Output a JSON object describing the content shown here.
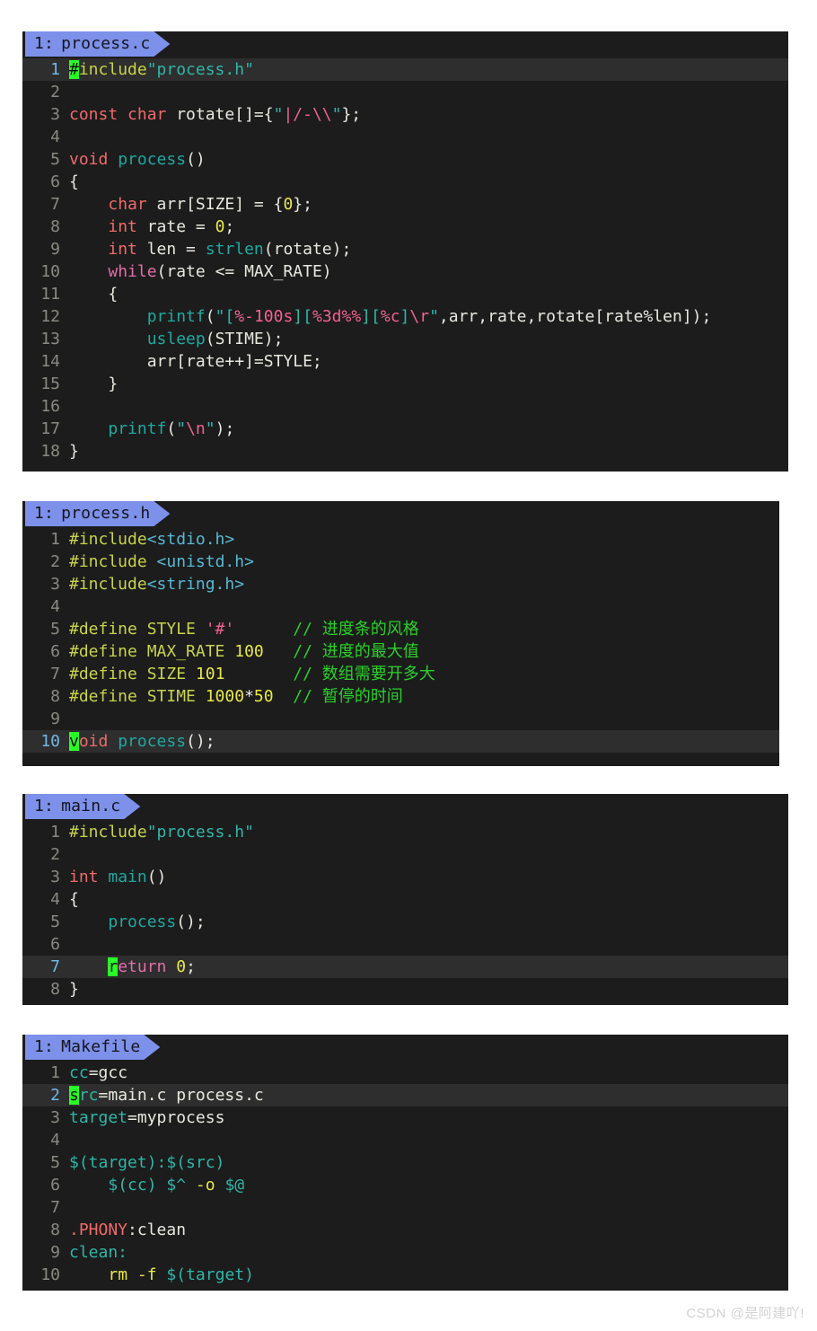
{
  "watermark": "CSDN @是阿建吖!",
  "colors": {
    "page_background": "#ffffff",
    "editor_background": "#1c1c1c",
    "tab_background": "#7d90ea",
    "highlight_line": "#2e2e2e",
    "cursor": "#27ff27",
    "line_number": "#8a8a82",
    "active_line_number": "#6fb8e8",
    "comment": "#2ad02a",
    "string": "#2fb6a8",
    "keyword": "#f06a6a",
    "control_keyword": "#e36ea8",
    "preprocessor": "#c8d44a",
    "number": "#e8e84a",
    "format_specifier": "#f06292"
  },
  "blocks": [
    {
      "tab_index": "1:",
      "filename": "process.c",
      "cursor_line": 1,
      "line_count": 18,
      "lines": [
        {
          "n": "1",
          "text": "#include\"process.h\""
        },
        {
          "n": "2",
          "text": ""
        },
        {
          "n": "3",
          "text": "const char rotate[]={\"|/-\\\\\"};"
        },
        {
          "n": "4",
          "text": ""
        },
        {
          "n": "5",
          "text": "void process()"
        },
        {
          "n": "6",
          "text": "{"
        },
        {
          "n": "7",
          "text": "    char arr[SIZE] = {0};"
        },
        {
          "n": "8",
          "text": "    int rate = 0;"
        },
        {
          "n": "9",
          "text": "    int len = strlen(rotate);"
        },
        {
          "n": "10",
          "text": "    while(rate <= MAX_RATE)"
        },
        {
          "n": "11",
          "text": "    {"
        },
        {
          "n": "12",
          "text": "        printf(\"[%-100s][%3d%%][%c]\\r\",arr,rate,rotate[rate%len]);"
        },
        {
          "n": "13",
          "text": "        usleep(STIME);"
        },
        {
          "n": "14",
          "text": "        arr[rate++]=STYLE;"
        },
        {
          "n": "15",
          "text": "    }"
        },
        {
          "n": "16",
          "text": ""
        },
        {
          "n": "17",
          "text": "    printf(\"\\n\");"
        },
        {
          "n": "18",
          "text": "}"
        }
      ]
    },
    {
      "tab_index": "1:",
      "filename": "process.h",
      "cursor_line": 10,
      "line_count": 10,
      "lines": [
        {
          "n": "1",
          "text": "#include<stdio.h>"
        },
        {
          "n": "2",
          "text": "#include <unistd.h>"
        },
        {
          "n": "3",
          "text": "#include<string.h>"
        },
        {
          "n": "4",
          "text": ""
        },
        {
          "n": "5",
          "text": "#define STYLE '#'        // 进度条的风格"
        },
        {
          "n": "6",
          "text": "#define MAX_RATE 100      // 进度的最大值"
        },
        {
          "n": "7",
          "text": "#define SIZE 101          // 数组需要开多大"
        },
        {
          "n": "8",
          "text": "#define STIME 1000*50     // 暂停的时间"
        },
        {
          "n": "9",
          "text": ""
        },
        {
          "n": "10",
          "text": "void process();"
        }
      ],
      "comments": [
        "// 进度条的风格",
        "// 进度的最大值",
        "// 数组需要开多大",
        "// 暂停的时间"
      ]
    },
    {
      "tab_index": "1:",
      "filename": "main.c",
      "cursor_line": 7,
      "line_count": 8,
      "lines": [
        {
          "n": "1",
          "text": "#include\"process.h\""
        },
        {
          "n": "2",
          "text": ""
        },
        {
          "n": "3",
          "text": "int main()"
        },
        {
          "n": "4",
          "text": "{"
        },
        {
          "n": "5",
          "text": "    process();"
        },
        {
          "n": "6",
          "text": ""
        },
        {
          "n": "7",
          "text": "    return 0;"
        },
        {
          "n": "8",
          "text": "}"
        }
      ]
    },
    {
      "tab_index": "1:",
      "filename": "Makefile",
      "cursor_line": 2,
      "line_count": 10,
      "lines": [
        {
          "n": "1",
          "text": "cc=gcc"
        },
        {
          "n": "2",
          "text": "src=main.c process.c"
        },
        {
          "n": "3",
          "text": "target=myprocess"
        },
        {
          "n": "4",
          "text": ""
        },
        {
          "n": "5",
          "text": "$(target):$(src)"
        },
        {
          "n": "6",
          "text": "    $(cc) $^ -o $@"
        },
        {
          "n": "7",
          "text": ""
        },
        {
          "n": "8",
          "text": ".PHONY:clean"
        },
        {
          "n": "9",
          "text": "clean:"
        },
        {
          "n": "10",
          "text": "    rm -f $(target)"
        }
      ]
    }
  ]
}
